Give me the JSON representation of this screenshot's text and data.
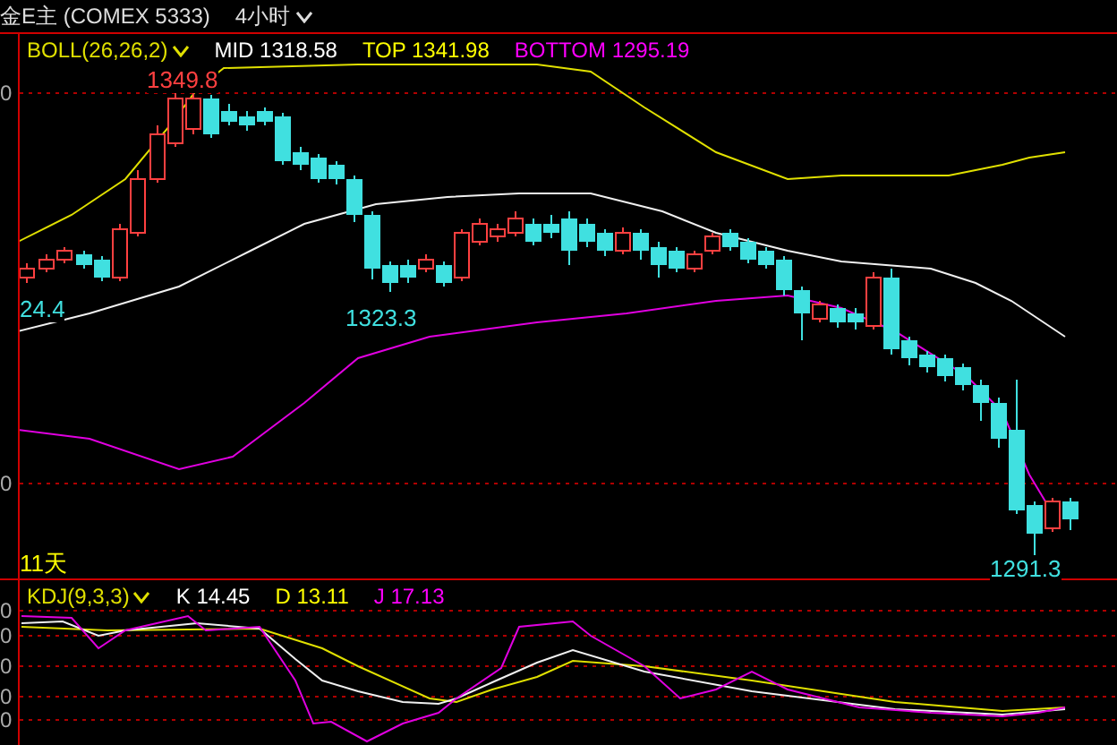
{
  "header": {
    "symbol": "金E主 (COMEX 5333)",
    "period": "4小时"
  },
  "main_panel": {
    "indicator": "BOLL(26,26,2)",
    "readings": [
      {
        "label": "MID 1318.58",
        "color": "#ffffff"
      },
      {
        "label": "TOP 1341.98",
        "color": "#ffff00"
      },
      {
        "label": "BOTTOM 1295.19",
        "color": "#ff00ff"
      }
    ],
    "axis_labels": [
      "0",
      "0"
    ],
    "price_marks": [
      {
        "text": "1349.8",
        "color": "#ff4040"
      },
      {
        "text": "1323.3",
        "color": "#40e0e0"
      },
      {
        "text": "1291.3",
        "color": "#40e0e0"
      },
      {
        "text": "24.4",
        "color": "#40e0e0"
      },
      {
        "text": "11天",
        "color": "#ffff00"
      }
    ]
  },
  "kdj_panel": {
    "indicator": "KDJ(9,3,3)",
    "readings": [
      {
        "label": "K 14.45",
        "color": "#ffffff"
      },
      {
        "label": "D 13.11",
        "color": "#ffff00"
      },
      {
        "label": "J 17.13",
        "color": "#ff00ff"
      }
    ],
    "axis_labels": [
      "0",
      "0",
      "0",
      "0",
      "0"
    ]
  }
}
